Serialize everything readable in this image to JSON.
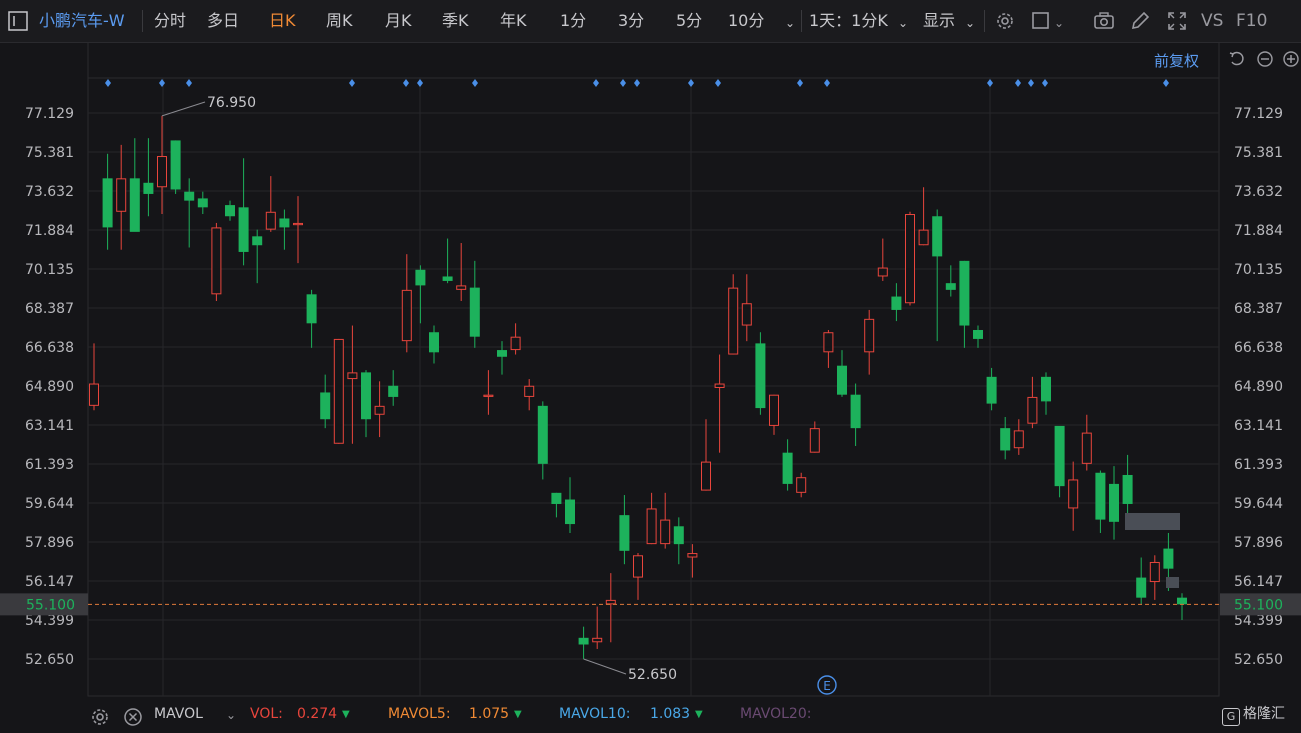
{
  "toolbar": {
    "stock_name": "小鹏汽车-W",
    "periods": [
      "分时",
      "多日",
      "日K",
      "周K",
      "月K",
      "季K",
      "年K",
      "1分",
      "3分",
      "5分",
      "10分"
    ],
    "active_period": "日K",
    "range_label": "1天：1分K",
    "display_label": "显示",
    "vs_label": "VS",
    "f10_label": "F10",
    "adjust_label": "前复权"
  },
  "colors": {
    "up": "#e8453c",
    "down": "#1db25c",
    "accent": "#f08a35",
    "link": "#5b9bf0",
    "price_line": "#e07a3a"
  },
  "chart_data": {
    "type": "candlestick",
    "y_ticks": [
      "77.129",
      "75.381",
      "73.632",
      "71.884",
      "70.135",
      "68.387",
      "66.638",
      "64.890",
      "63.141",
      "61.393",
      "59.644",
      "57.896",
      "56.147",
      "54.399",
      "52.650"
    ],
    "ylim": [
      52.65,
      77.129
    ],
    "current_price": "55.100",
    "high_label": "76.950",
    "low_label": "52.650",
    "candles": [
      {
        "o": 64.0,
        "c": 65.0,
        "h": 66.8,
        "l": 63.8
      },
      {
        "o": 74.2,
        "c": 72.0,
        "h": 75.3,
        "l": 71.0
      },
      {
        "o": 72.7,
        "c": 74.2,
        "h": 75.7,
        "l": 71.0
      },
      {
        "o": 74.2,
        "c": 71.8,
        "h": 76.0,
        "l": 72.4
      },
      {
        "o": 74.0,
        "c": 73.5,
        "h": 76.0,
        "l": 72.5
      },
      {
        "o": 73.8,
        "c": 75.2,
        "h": 77.0,
        "l": 72.6
      },
      {
        "o": 75.9,
        "c": 73.7,
        "h": 75.9,
        "l": 73.5
      },
      {
        "o": 73.6,
        "c": 73.2,
        "h": 74.2,
        "l": 71.1
      },
      {
        "o": 73.3,
        "c": 72.9,
        "h": 73.6,
        "l": 72.6
      },
      {
        "o": 69.0,
        "c": 72.0,
        "h": 72.2,
        "l": 68.7
      },
      {
        "o": 73.0,
        "c": 72.5,
        "h": 73.2,
        "l": 72.3
      },
      {
        "o": 72.9,
        "c": 70.9,
        "h": 75.1,
        "l": 70.3
      },
      {
        "o": 71.6,
        "c": 71.2,
        "h": 71.9,
        "l": 69.5
      },
      {
        "o": 71.9,
        "c": 72.7,
        "h": 74.3,
        "l": 71.8
      },
      {
        "o": 72.4,
        "c": 72.0,
        "h": 72.8,
        "l": 71.0
      },
      {
        "o": 72.1,
        "c": 72.2,
        "h": 73.4,
        "l": 70.4
      },
      {
        "o": 69.0,
        "c": 67.7,
        "h": 69.2,
        "l": 66.6
      },
      {
        "o": 64.6,
        "c": 63.4,
        "h": 65.4,
        "l": 63.0
      },
      {
        "o": 62.3,
        "c": 67.0,
        "h": 67.0,
        "l": 62.3
      },
      {
        "o": 65.2,
        "c": 65.5,
        "h": 67.6,
        "l": 62.3
      },
      {
        "o": 65.5,
        "c": 63.4,
        "h": 65.6,
        "l": 62.6
      },
      {
        "o": 63.6,
        "c": 64.0,
        "h": 65.1,
        "l": 62.6
      },
      {
        "o": 64.9,
        "c": 64.4,
        "h": 65.6,
        "l": 64.0
      },
      {
        "o": 66.9,
        "c": 69.2,
        "h": 70.8,
        "l": 66.4
      },
      {
        "o": 70.1,
        "c": 69.4,
        "h": 70.3,
        "l": 67.7
      },
      {
        "o": 67.3,
        "c": 66.4,
        "h": 67.6,
        "l": 65.9
      },
      {
        "o": 69.8,
        "c": 69.6,
        "h": 71.5,
        "l": 69.5
      },
      {
        "o": 69.2,
        "c": 69.4,
        "h": 71.3,
        "l": 68.7
      },
      {
        "o": 69.3,
        "c": 67.1,
        "h": 70.5,
        "l": 66.6
      },
      {
        "o": 64.4,
        "c": 64.5,
        "h": 65.6,
        "l": 63.6
      },
      {
        "o": 66.5,
        "c": 66.2,
        "h": 66.9,
        "l": 65.4
      },
      {
        "o": 66.5,
        "c": 67.1,
        "h": 67.7,
        "l": 66.3
      },
      {
        "o": 64.4,
        "c": 64.9,
        "h": 65.2,
        "l": 63.8
      },
      {
        "o": 64.0,
        "c": 61.4,
        "h": 64.2,
        "l": 60.7
      },
      {
        "o": 60.1,
        "c": 59.6,
        "h": 60.1,
        "l": 59.0
      },
      {
        "o": 59.8,
        "c": 58.7,
        "h": 60.8,
        "l": 58.3
      },
      {
        "o": 53.6,
        "c": 53.3,
        "h": 54.1,
        "l": 52.65
      },
      {
        "o": 53.4,
        "c": 53.6,
        "h": 55.0,
        "l": 53.1
      },
      {
        "o": 55.1,
        "c": 55.3,
        "h": 56.5,
        "l": 53.4
      },
      {
        "o": 59.1,
        "c": 57.5,
        "h": 60.0,
        "l": 56.9
      },
      {
        "o": 56.3,
        "c": 57.3,
        "h": 57.4,
        "l": 55.3
      },
      {
        "o": 57.8,
        "c": 59.4,
        "h": 60.1,
        "l": 57.8
      },
      {
        "o": 57.8,
        "c": 58.9,
        "h": 60.1,
        "l": 57.6
      },
      {
        "o": 58.6,
        "c": 57.8,
        "h": 59.0,
        "l": 56.9
      },
      {
        "o": 57.2,
        "c": 57.4,
        "h": 57.8,
        "l": 56.3
      },
      {
        "o": 60.2,
        "c": 61.5,
        "h": 63.4,
        "l": 60.2
      },
      {
        "o": 64.8,
        "c": 65.0,
        "h": 66.3,
        "l": 61.9
      },
      {
        "o": 66.3,
        "c": 69.3,
        "h": 69.9,
        "l": 66.3
      },
      {
        "o": 67.6,
        "c": 68.6,
        "h": 69.9,
        "l": 66.9
      },
      {
        "o": 66.8,
        "c": 63.9,
        "h": 67.3,
        "l": 63.6
      },
      {
        "o": 63.1,
        "c": 64.5,
        "h": 64.5,
        "l": 62.7
      },
      {
        "o": 61.9,
        "c": 60.5,
        "h": 62.5,
        "l": 60.2
      },
      {
        "o": 60.1,
        "c": 60.8,
        "h": 61.0,
        "l": 59.9
      },
      {
        "o": 61.9,
        "c": 63.0,
        "h": 63.3,
        "l": 61.9
      },
      {
        "o": 66.4,
        "c": 67.3,
        "h": 67.4,
        "l": 65.7
      },
      {
        "o": 65.8,
        "c": 64.5,
        "h": 66.5,
        "l": 64.4
      },
      {
        "o": 64.5,
        "c": 63.0,
        "h": 65.0,
        "l": 62.2
      },
      {
        "o": 66.4,
        "c": 67.9,
        "h": 68.3,
        "l": 65.4
      },
      {
        "o": 69.8,
        "c": 70.2,
        "h": 71.5,
        "l": 69.6
      },
      {
        "o": 68.9,
        "c": 68.3,
        "h": 69.5,
        "l": 67.8
      },
      {
        "o": 68.6,
        "c": 72.6,
        "h": 72.7,
        "l": 68.5
      },
      {
        "o": 71.2,
        "c": 71.9,
        "h": 73.8,
        "l": 71.2
      },
      {
        "o": 72.5,
        "c": 70.7,
        "h": 72.8,
        "l": 66.9
      },
      {
        "o": 69.5,
        "c": 69.2,
        "h": 70.3,
        "l": 68.9
      },
      {
        "o": 70.5,
        "c": 67.6,
        "h": 70.5,
        "l": 66.6
      },
      {
        "o": 67.4,
        "c": 67.0,
        "h": 67.6,
        "l": 66.6
      },
      {
        "o": 65.3,
        "c": 64.1,
        "h": 65.7,
        "l": 63.8
      },
      {
        "o": 63.0,
        "c": 62.0,
        "h": 63.5,
        "l": 61.6
      },
      {
        "o": 62.1,
        "c": 62.9,
        "h": 63.4,
        "l": 61.8
      },
      {
        "o": 63.2,
        "c": 64.4,
        "h": 65.3,
        "l": 63.0
      },
      {
        "o": 65.3,
        "c": 64.2,
        "h": 65.5,
        "l": 63.6
      },
      {
        "o": 63.1,
        "c": 60.4,
        "h": 63.0,
        "l": 59.9
      },
      {
        "o": 59.4,
        "c": 60.7,
        "h": 61.5,
        "l": 58.4
      },
      {
        "o": 61.4,
        "c": 62.8,
        "h": 63.6,
        "l": 61.1
      },
      {
        "o": 61.0,
        "c": 58.9,
        "h": 61.1,
        "l": 58.3
      },
      {
        "o": 60.5,
        "c": 58.8,
        "h": 61.3,
        "l": 58.0
      },
      {
        "o": 60.9,
        "c": 59.6,
        "h": 61.8,
        "l": 58.6
      },
      {
        "o": 56.3,
        "c": 55.4,
        "h": 57.2,
        "l": 55.1
      },
      {
        "o": 56.1,
        "c": 57.0,
        "h": 57.3,
        "l": 55.3
      },
      {
        "o": 57.6,
        "c": 56.7,
        "h": 58.3,
        "l": 55.7
      },
      {
        "o": 55.4,
        "c": 55.1,
        "h": 55.6,
        "l": 54.4
      }
    ]
  },
  "bottom": {
    "indicator": "MAVOL",
    "vol_label": "VOL:",
    "vol_value": "0.274",
    "mavol5_label": "MAVOL5:",
    "mavol5_value": "1.075",
    "mavol10_label": "MAVOL10:",
    "mavol10_value": "1.083",
    "mavol20_label": "MAVOL20:",
    "e_marker": "E",
    "brand": "格隆汇"
  }
}
